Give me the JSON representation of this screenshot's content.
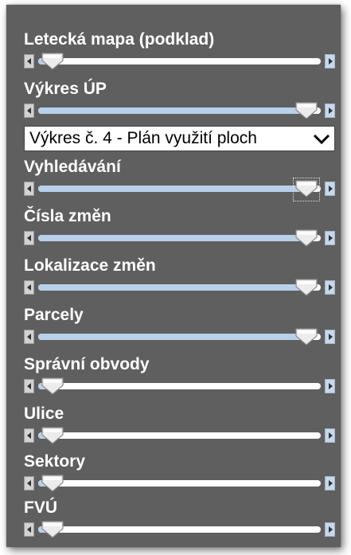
{
  "layers": [
    {
      "label": "Letecká mapa (podklad)",
      "value": 0.05
    },
    {
      "label": "Výkres ÚP",
      "value": 0.95
    },
    {
      "label": "Vyhledávání",
      "value": 0.95
    },
    {
      "label": "Čísla změn",
      "value": 0.95
    },
    {
      "label": "Lokalizace změn",
      "value": 0.95
    },
    {
      "label": "Parcely",
      "value": 0.95
    },
    {
      "label": "Správní obvody",
      "value": 0.05
    },
    {
      "label": "Ulice",
      "value": 0.05
    },
    {
      "label": "Sektory",
      "value": 0.05
    },
    {
      "label": "FVÚ",
      "value": 0.05
    }
  ],
  "drawing_select": {
    "value": "Výkres č. 4 - Plán využití ploch"
  }
}
